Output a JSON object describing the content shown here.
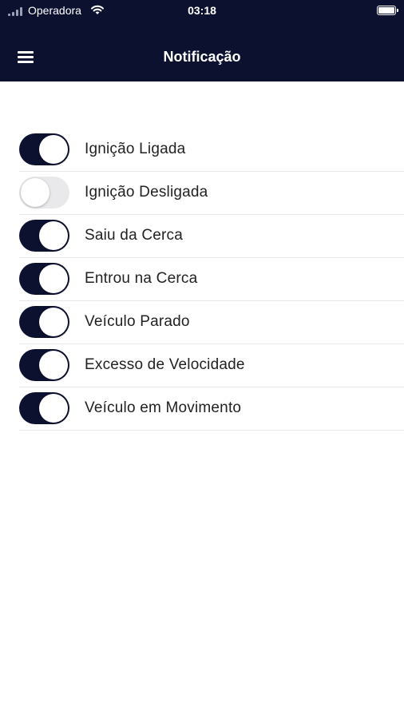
{
  "status_bar": {
    "carrier": "Operadora",
    "time": "03:18"
  },
  "header": {
    "title": "Notificação",
    "menu_icon": "hamburger-menu-icon"
  },
  "colors": {
    "navy": "#0d1130",
    "toggle_off": "#e9e9eb",
    "divider": "#e8e8ea"
  },
  "notifications": [
    {
      "label": "Ignição Ligada",
      "enabled": true
    },
    {
      "label": "Ignição Desligada",
      "enabled": false
    },
    {
      "label": "Saiu da Cerca",
      "enabled": true
    },
    {
      "label": "Entrou na Cerca",
      "enabled": true
    },
    {
      "label": "Veículo Parado",
      "enabled": true
    },
    {
      "label": "Excesso de Velocidade",
      "enabled": true
    },
    {
      "label": "Veículo em Movimento",
      "enabled": true
    }
  ]
}
